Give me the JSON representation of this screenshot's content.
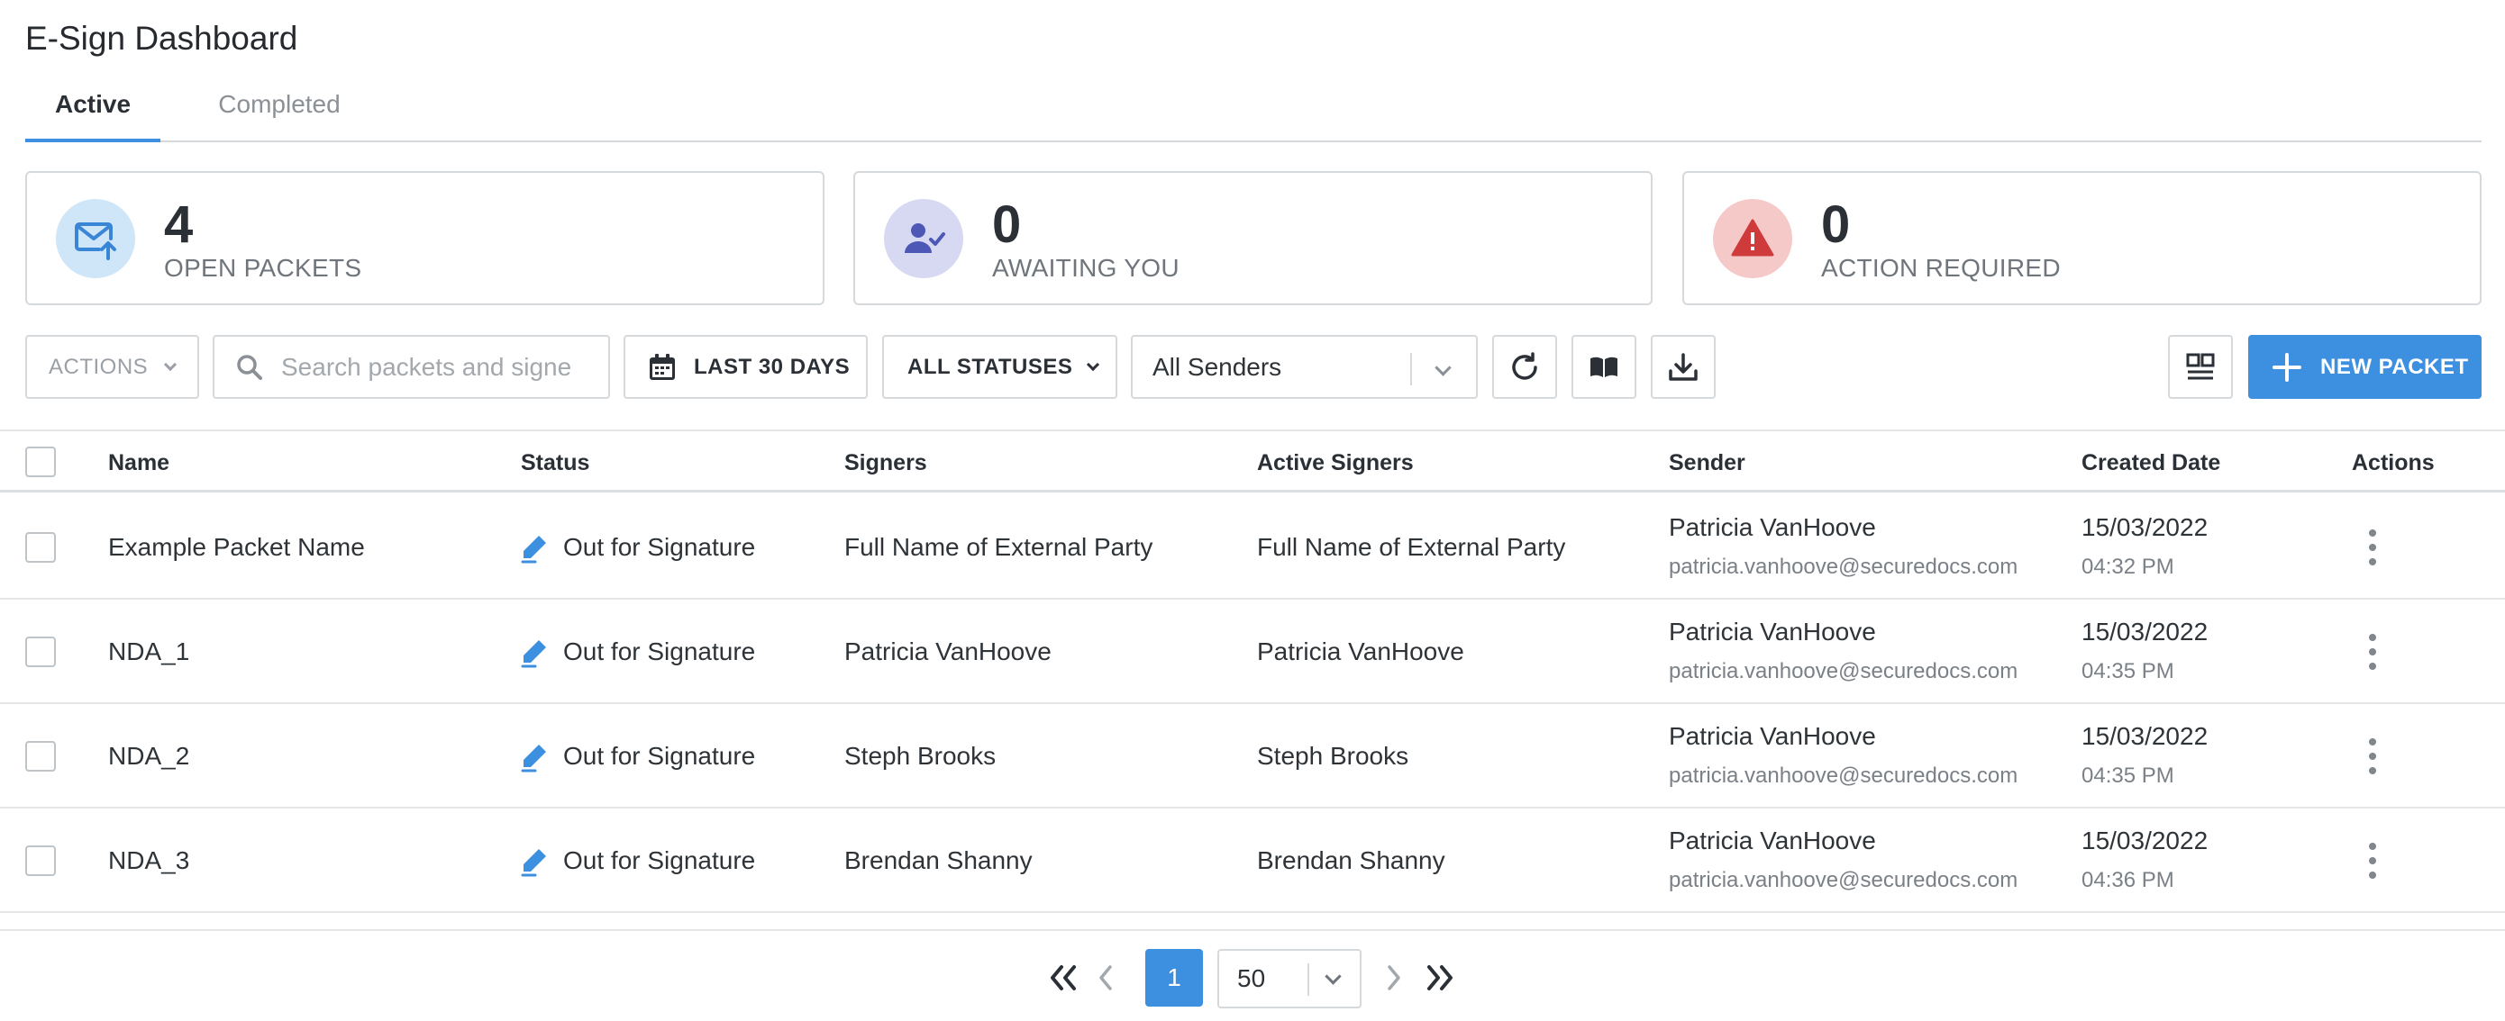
{
  "app": {
    "title": "E-Sign Dashboard"
  },
  "tabs": [
    {
      "label": "Active",
      "active": true
    },
    {
      "label": "Completed",
      "active": false
    }
  ],
  "summary": [
    {
      "value": "4",
      "label": "OPEN PACKETS",
      "icon": "mail-send-icon",
      "bg": "#cfe5f8",
      "fg": "#3a86d6"
    },
    {
      "value": "0",
      "label": "AWAITING YOU",
      "icon": "user-check-icon",
      "bg": "#d7d9f2",
      "fg": "#4c57b6"
    },
    {
      "value": "0",
      "label": "ACTION REQUIRED",
      "icon": "warning-icon",
      "bg": "#f6c9c9",
      "fg": "#cf3a3a"
    }
  ],
  "toolbar": {
    "actions_label": "ACTIONS",
    "search_placeholder": "Search packets and signe",
    "date_filter": "LAST 30 DAYS",
    "status_filter": "ALL STATUSES",
    "sender_filter": "All Senders",
    "new_packet": "NEW PACKET"
  },
  "table": {
    "columns": [
      "Name",
      "Status",
      "Signers",
      "Active Signers",
      "Sender",
      "Created Date",
      "Actions"
    ],
    "rows": [
      {
        "name": "Example Packet Name",
        "status": "Out for Signature",
        "signers": "Full Name of External Party",
        "active_signers": "Full Name of External Party",
        "sender_name": "Patricia VanHoove",
        "sender_email": "patricia.vanhoove@securedocs.com",
        "date": "15/03/2022",
        "time": "04:32 PM"
      },
      {
        "name": "NDA_1",
        "status": "Out for Signature",
        "signers": "Patricia VanHoove",
        "active_signers": "Patricia VanHoove",
        "sender_name": "Patricia VanHoove",
        "sender_email": "patricia.vanhoove@securedocs.com",
        "date": "15/03/2022",
        "time": "04:35 PM"
      },
      {
        "name": "NDA_2",
        "status": "Out for Signature",
        "signers": "Steph Brooks",
        "active_signers": "Steph Brooks",
        "sender_name": "Patricia VanHoove",
        "sender_email": "patricia.vanhoove@securedocs.com",
        "date": "15/03/2022",
        "time": "04:35 PM"
      },
      {
        "name": "NDA_3",
        "status": "Out for Signature",
        "signers": "Brendan Shanny",
        "active_signers": "Brendan Shanny",
        "sender_name": "Patricia VanHoove",
        "sender_email": "patricia.vanhoove@securedocs.com",
        "date": "15/03/2022",
        "time": "04:36 PM"
      }
    ]
  },
  "pagination": {
    "current_page": "1",
    "page_size": "50"
  },
  "colors": {
    "accent": "#3d8fe0",
    "border": "#d6d9dc"
  }
}
